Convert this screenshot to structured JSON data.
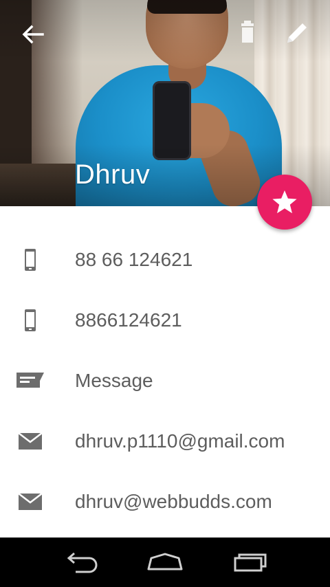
{
  "header": {
    "contact_name": "Dhruv",
    "back_icon": "arrow-left-icon",
    "delete_icon": "trash-icon",
    "edit_icon": "pencil-icon",
    "favorite_icon": "star-icon",
    "fab_color": "#e91e63"
  },
  "details": {
    "items": [
      {
        "icon": "phone-icon",
        "label": "88 66 124621"
      },
      {
        "icon": "phone-icon",
        "label": "8866124621"
      },
      {
        "icon": "message-icon",
        "label": "Message"
      },
      {
        "icon": "email-icon",
        "label": "dhruv.p1110@gmail.com"
      },
      {
        "icon": "email-icon",
        "label": "dhruv@webbudds.com"
      }
    ]
  },
  "navbar": {
    "back_icon": "nav-back-icon",
    "home_icon": "nav-home-icon",
    "recents_icon": "nav-recents-icon"
  }
}
